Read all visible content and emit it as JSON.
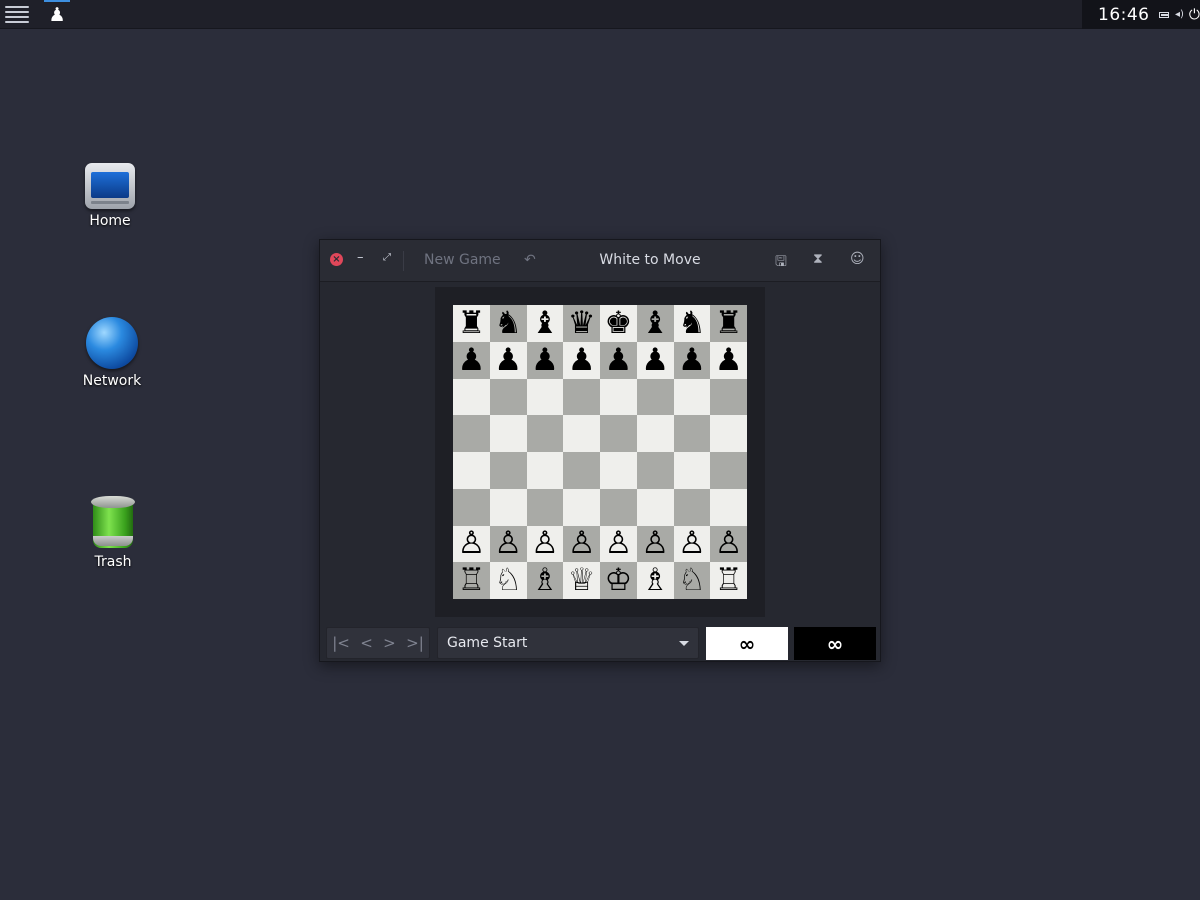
{
  "top_panel": {
    "clock": "16:46",
    "task_icon": "♟"
  },
  "desktop": {
    "icons": [
      {
        "label": "Home",
        "icon": "computer-icon"
      },
      {
        "label": "Network",
        "icon": "globe-icon"
      },
      {
        "label": "Trash",
        "icon": "trash-icon"
      }
    ]
  },
  "window": {
    "new_game_label": "New Game",
    "title": "White to Move",
    "undo_glyph": "↶",
    "close_glyph": "×",
    "minimize_glyph": "–",
    "maximize_glyph": "⤢",
    "right_icons": [
      "🖫",
      "⧗",
      "☺"
    ]
  },
  "board": {
    "ranks": [
      [
        "♜",
        "♞",
        "♝",
        "♛",
        "♚",
        "♝",
        "♞",
        "♜"
      ],
      [
        "♟",
        "♟",
        "♟",
        "♟",
        "♟",
        "♟",
        "♟",
        "♟"
      ],
      [
        "",
        "",
        "",
        "",
        "",
        "",
        "",
        ""
      ],
      [
        "",
        "",
        "",
        "",
        "",
        "",
        "",
        ""
      ],
      [
        "",
        "",
        "",
        "",
        "",
        "",
        "",
        ""
      ],
      [
        "",
        "",
        "",
        "",
        "",
        "",
        "",
        ""
      ],
      [
        "♙",
        "♙",
        "♙",
        "♙",
        "♙",
        "♙",
        "♙",
        "♙"
      ],
      [
        "♖",
        "♘",
        "♗",
        "♕",
        "♔",
        "♗",
        "♘",
        "♖"
      ]
    ]
  },
  "bottom_bar": {
    "nav": {
      "first": "|<",
      "prev": "<",
      "next": ">",
      "last": ">|"
    },
    "history_selected": "Game Start",
    "white_clock": "∞",
    "black_clock": "∞"
  }
}
